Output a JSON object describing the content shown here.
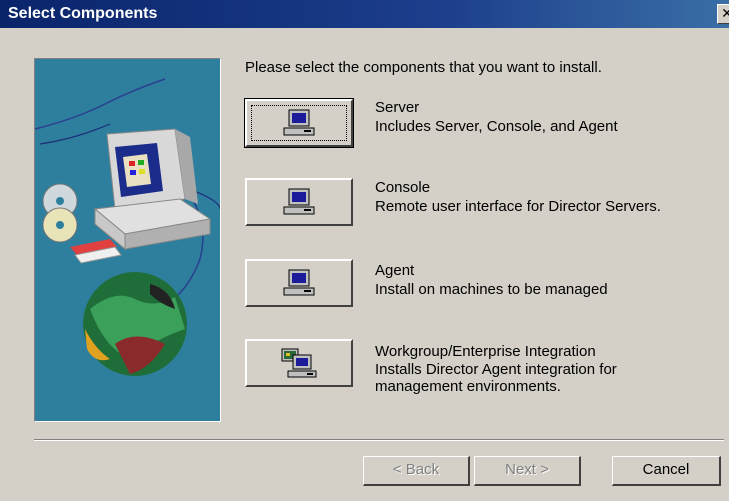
{
  "window": {
    "title": "Select Components",
    "close_glyph": "✕"
  },
  "intro_text": "Please select the components that you want to install.",
  "options": [
    {
      "name": "Server",
      "description": "Includes Server, Console, and Agent",
      "icon": "computer-icon"
    },
    {
      "name": "Console",
      "description": "Remote user interface for Director Servers.",
      "icon": "computer-icon"
    },
    {
      "name": "Agent",
      "description": "Install on machines to be managed",
      "icon": "computer-icon"
    },
    {
      "name": "Workgroup/Enterprise Integration",
      "description": "Installs Director Agent integration for management environments.",
      "icon": "networked-computers-icon"
    }
  ],
  "buttons": {
    "back": {
      "label": "< Back",
      "enabled": false
    },
    "next": {
      "label": "Next >",
      "enabled": false
    },
    "cancel": {
      "label": "Cancel",
      "enabled": true
    }
  }
}
